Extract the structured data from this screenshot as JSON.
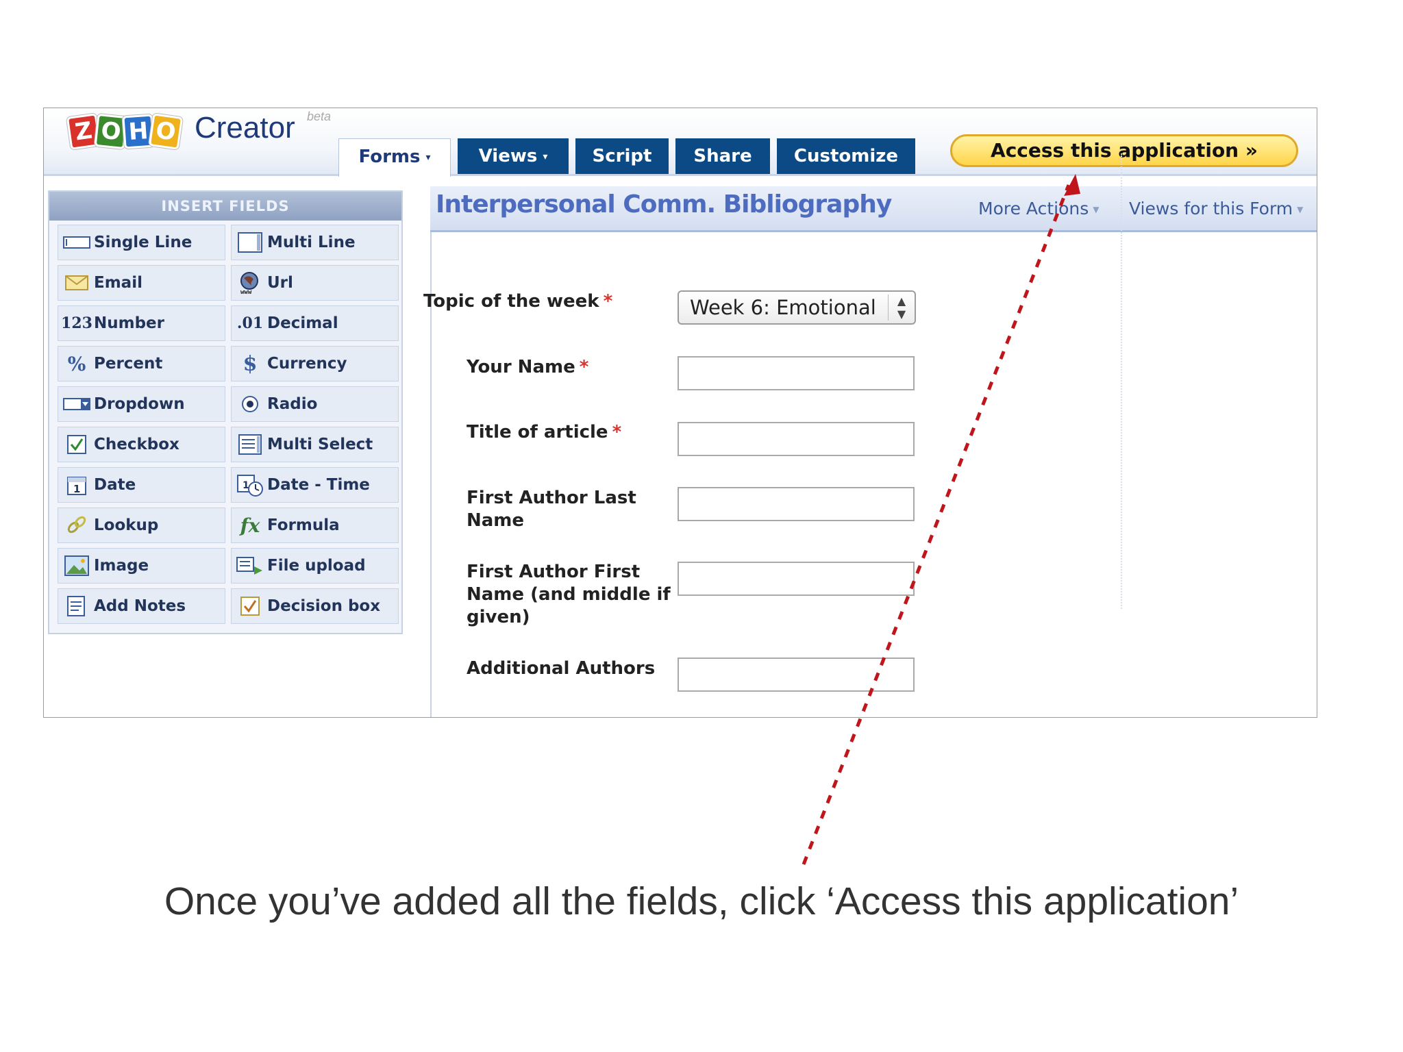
{
  "header": {
    "logo_letters": [
      "Z",
      "O",
      "H",
      "O"
    ],
    "logo_colors": [
      "#d9322a",
      "#3c8a2e",
      "#2a6fc9",
      "#f0b21c"
    ],
    "product_name": "Creator",
    "beta_label": "beta",
    "tabs": [
      {
        "label": "Forms",
        "caret": "▾"
      },
      {
        "label": "Views",
        "caret": "▾"
      },
      {
        "label": "Script"
      },
      {
        "label": "Share"
      },
      {
        "label": "Customize"
      }
    ],
    "access_button": "Access this application »"
  },
  "sidebar": {
    "title": "INSERT FIELDS",
    "fields": [
      {
        "label": "Single Line",
        "icon": "single-line-icon"
      },
      {
        "label": "Multi Line",
        "icon": "multi-line-icon"
      },
      {
        "label": "Email",
        "icon": "email-icon"
      },
      {
        "label": "Url",
        "icon": "globe-icon"
      },
      {
        "label": "Number",
        "icon": "number-icon",
        "icon_text": "123"
      },
      {
        "label": "Decimal",
        "icon": "decimal-icon",
        "icon_text": ".01"
      },
      {
        "label": "Percent",
        "icon": "percent-icon",
        "icon_text": "%"
      },
      {
        "label": "Currency",
        "icon": "dollar-icon",
        "icon_text": "$"
      },
      {
        "label": "Dropdown",
        "icon": "dropdown-icon"
      },
      {
        "label": "Radio",
        "icon": "radio-icon"
      },
      {
        "label": "Checkbox",
        "icon": "checkbox-icon"
      },
      {
        "label": "Multi Select",
        "icon": "multi-select-icon"
      },
      {
        "label": "Date",
        "icon": "calendar-icon"
      },
      {
        "label": "Date - Time",
        "icon": "calendar-clock-icon"
      },
      {
        "label": "Lookup",
        "icon": "link-icon"
      },
      {
        "label": "Formula",
        "icon": "formula-icon",
        "icon_text": "fx"
      },
      {
        "label": "Image",
        "icon": "image-icon"
      },
      {
        "label": "File upload",
        "icon": "file-upload-icon"
      },
      {
        "label": "Add Notes",
        "icon": "notes-icon"
      },
      {
        "label": "Decision box",
        "icon": "decision-box-icon"
      }
    ]
  },
  "form": {
    "title": "Interpersonal Comm. Bibliography",
    "more_actions": "More Actions",
    "views_for_form": "Views for this Form",
    "required_marker": "*",
    "topic_label": "Topic of the week",
    "topic_value": "Week 6: Emotional",
    "your_name_label": "Your Name",
    "title_label": "Title of article",
    "first_author_last_label": "First Author Last Name",
    "first_author_first_label": "First Author First Name (and middle if given)",
    "additional_authors_label": "Additional Authors"
  },
  "annotation": {
    "arrow_color": "#c0161b",
    "caption": "Once you’ve added all the fields, click ‘Access this application’"
  }
}
